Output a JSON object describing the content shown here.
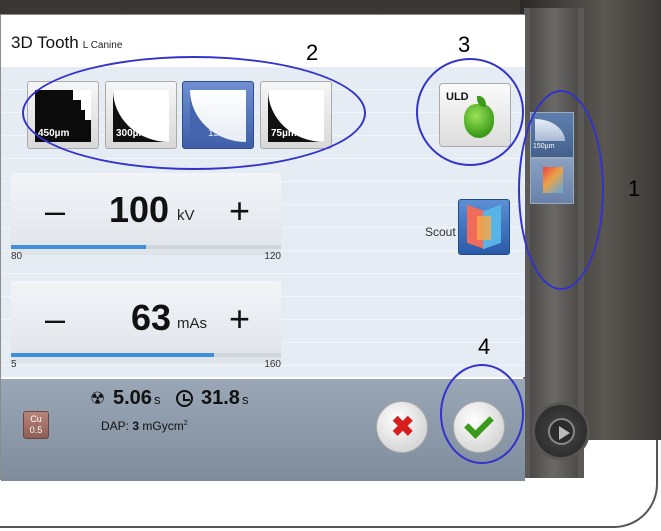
{
  "dialog": {
    "title": "3D Tooth",
    "subtitle": "L Canine"
  },
  "resolutions": [
    {
      "label": "450µm",
      "selected": false
    },
    {
      "label": "300µm",
      "selected": false
    },
    {
      "label": "150µm",
      "selected": true
    },
    {
      "label": "75µm",
      "selected": false
    }
  ],
  "uld": {
    "label": "ULD",
    "icon": "apple-icon"
  },
  "scout": {
    "label": "Scout",
    "icon": "scout-icon"
  },
  "kv": {
    "minus": "–",
    "value": "100",
    "unit": "kV",
    "plus": "+",
    "min": "80",
    "max": "120",
    "level": 0.5
  },
  "mas": {
    "minus": "–",
    "value": "63",
    "unit": "mAs",
    "plus": "+",
    "min": "5",
    "max": "160",
    "level": 0.75
  },
  "status": {
    "filter_top": "Cu",
    "filter_bottom": "0.5",
    "exposure_time": "5.06",
    "exposure_unit": "s",
    "scan_time": "31.8",
    "scan_unit": "s",
    "dap_label": "DAP:",
    "dap_value": "3",
    "dap_unit": "mGycm",
    "dap_unit_sup": "2"
  },
  "side_panel": {
    "thumb_label": "150µm"
  },
  "annotations": [
    "1",
    "2",
    "3",
    "4"
  ],
  "colors": {
    "accent": "#3f8fdd",
    "selected": "#4465ad",
    "annotation": "#3333cc",
    "cancel": "#d91d1d",
    "confirm": "#3a9a1a"
  }
}
